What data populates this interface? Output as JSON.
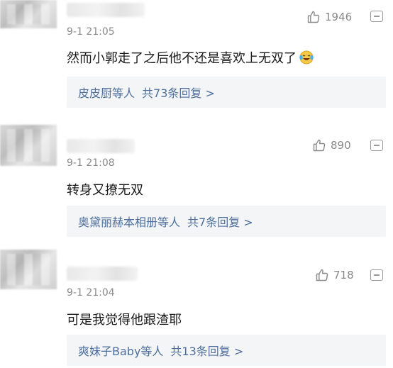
{
  "comments": [
    {
      "time": "9-1 21:05",
      "text": "然而小郭走了之后他不还是喜欢上无双了",
      "emoji": "laughing-tears-emoji",
      "likes": "1946",
      "reply_names": "皮皮厨等人",
      "reply_count": "共73条回复 >"
    },
    {
      "time": "9-1 21:08",
      "text": "转身又撩无双",
      "likes": "890",
      "reply_names": "奥黛丽赫本相册等人",
      "reply_count": "共7条回复 >"
    },
    {
      "time": "9-1 21:04",
      "text": "可是我觉得他跟渣耶",
      "likes": "718",
      "reply_names": "爽妹子Baby等人",
      "reply_count": "共13条回复 >"
    }
  ],
  "icons": {
    "like": "thumbs-up-icon",
    "menu": "comment-menu-icon"
  },
  "colors": {
    "link": "#4e6f9c",
    "muted": "#8a8a8a",
    "reply_bg": "#f4f5f7"
  }
}
